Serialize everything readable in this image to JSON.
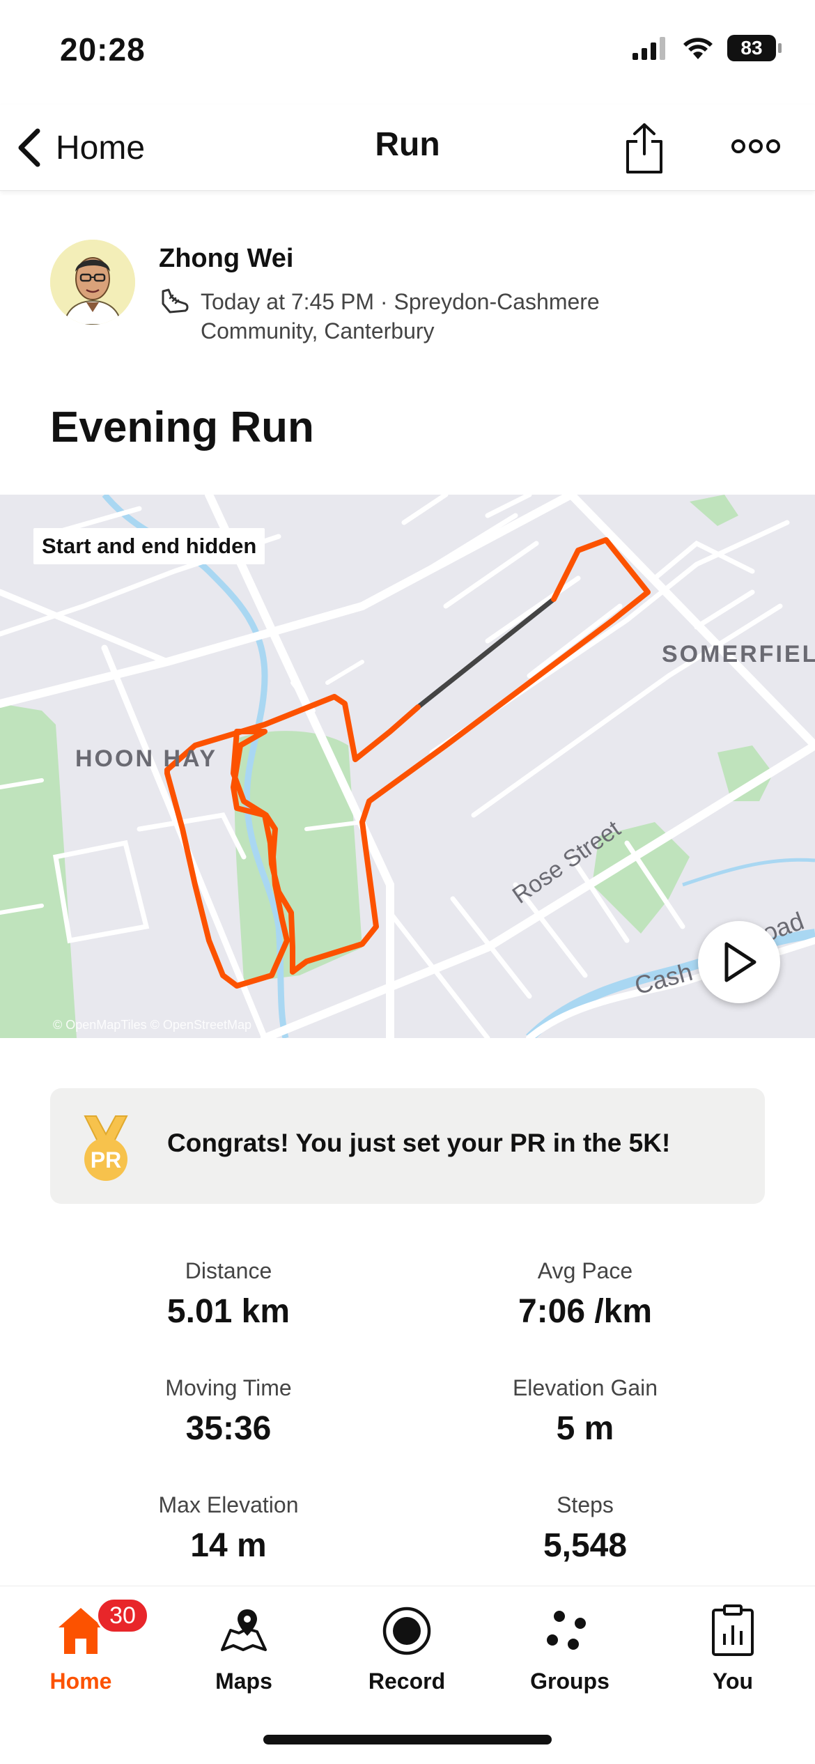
{
  "status_bar": {
    "time": "20:28",
    "battery": "83"
  },
  "nav": {
    "back_label": "Home",
    "title": "Run"
  },
  "athlete": {
    "name": "Zhong Wei",
    "meta": "Today at 7:45 PM · Spreydon-Cashmere Community, Canterbury"
  },
  "activity": {
    "title": "Evening Run"
  },
  "map": {
    "privacy_chip": "Start and end hidden",
    "labels": {
      "area1": "HOON HAY",
      "area2": "SOMERFIEL",
      "street1": "Rose Street",
      "street2": "Cash",
      "street3": "oad"
    },
    "attribution": "© OpenMapTiles © OpenStreetMap",
    "route_color": "#fc5200"
  },
  "pr": {
    "text": "Congrats! You just set your PR in the 5K!",
    "medal_text": "PR",
    "medal_color": "#f7c24c"
  },
  "stats": [
    {
      "label": "Distance",
      "value": "5.01 km"
    },
    {
      "label": "Avg Pace",
      "value": "7:06 /km"
    },
    {
      "label": "Moving Time",
      "value": "35:36"
    },
    {
      "label": "Elevation Gain",
      "value": "5 m"
    },
    {
      "label": "Max Elevation",
      "value": "14 m"
    },
    {
      "label": "Steps",
      "value": "5,548"
    }
  ],
  "tabs": [
    {
      "label": "Home",
      "icon": "home-icon",
      "badge": "30",
      "active": true
    },
    {
      "label": "Maps",
      "icon": "maps-icon"
    },
    {
      "label": "Record",
      "icon": "record-icon"
    },
    {
      "label": "Groups",
      "icon": "groups-icon"
    },
    {
      "label": "You",
      "icon": "you-icon"
    }
  ],
  "colors": {
    "accent": "#fc5200",
    "badge": "#e8262a",
    "park": "#bfe3bc",
    "water": "#a9d7f2"
  }
}
